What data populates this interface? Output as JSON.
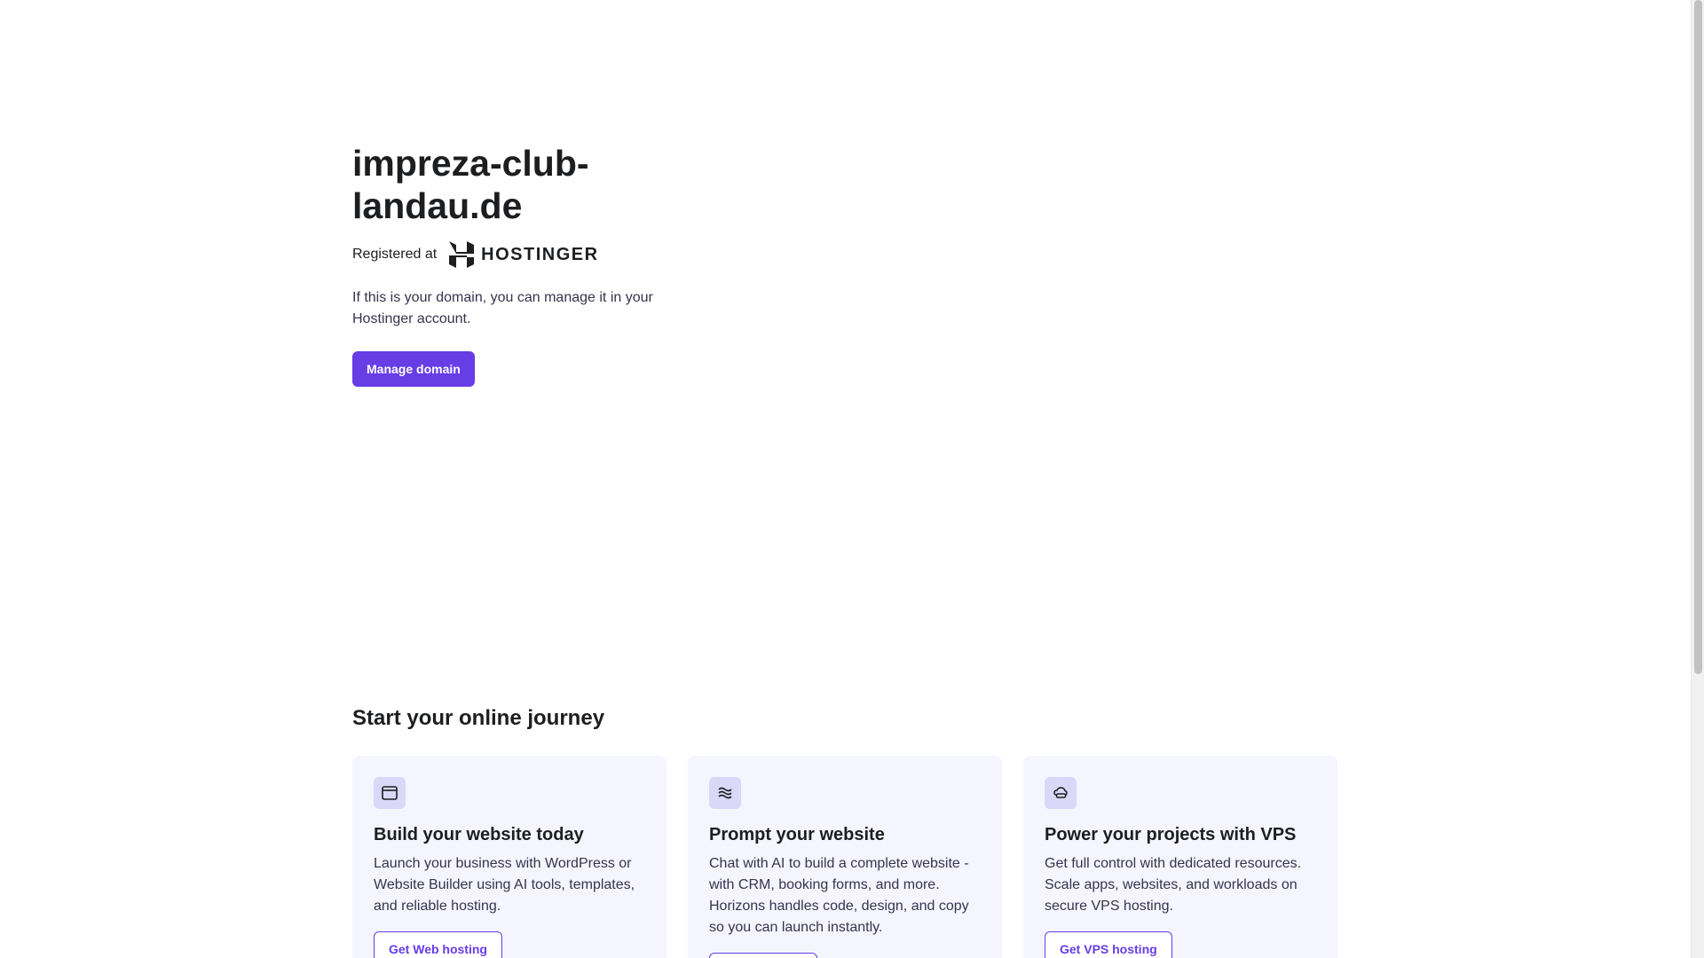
{
  "hero": {
    "domain": "impreza-club-landau.de",
    "registered_label": "Registered at",
    "logo_text": "HOSTINGER",
    "description": "If this is your domain, you can manage it in your Hostinger account.",
    "manage_button": "Manage domain"
  },
  "journey": {
    "title": "Start your online journey",
    "cards": [
      {
        "icon": "browser-window-icon",
        "title": "Build your website today",
        "description": "Launch your business with WordPress or Website Builder using AI tools, templates, and reliable hosting.",
        "button": "Get Web hosting"
      },
      {
        "icon": "waves-icon",
        "title": "Prompt your website",
        "description": "Chat with AI to build a complete website - with CRM, booking forms, and more. Horizons handles code, design, and copy so you can launch instantly.",
        "button": ""
      },
      {
        "icon": "cloud-server-icon",
        "title": "Power your projects with VPS",
        "description": "Get full control with dedicated resources. Scale apps, websites, and workloads on secure VPS hosting.",
        "button": "Get VPS hosting"
      }
    ]
  },
  "colors": {
    "accent": "#673de6",
    "card_bg": "#f4f5ff",
    "icon_bg": "#dad8f8",
    "text": "#1d1e20"
  }
}
